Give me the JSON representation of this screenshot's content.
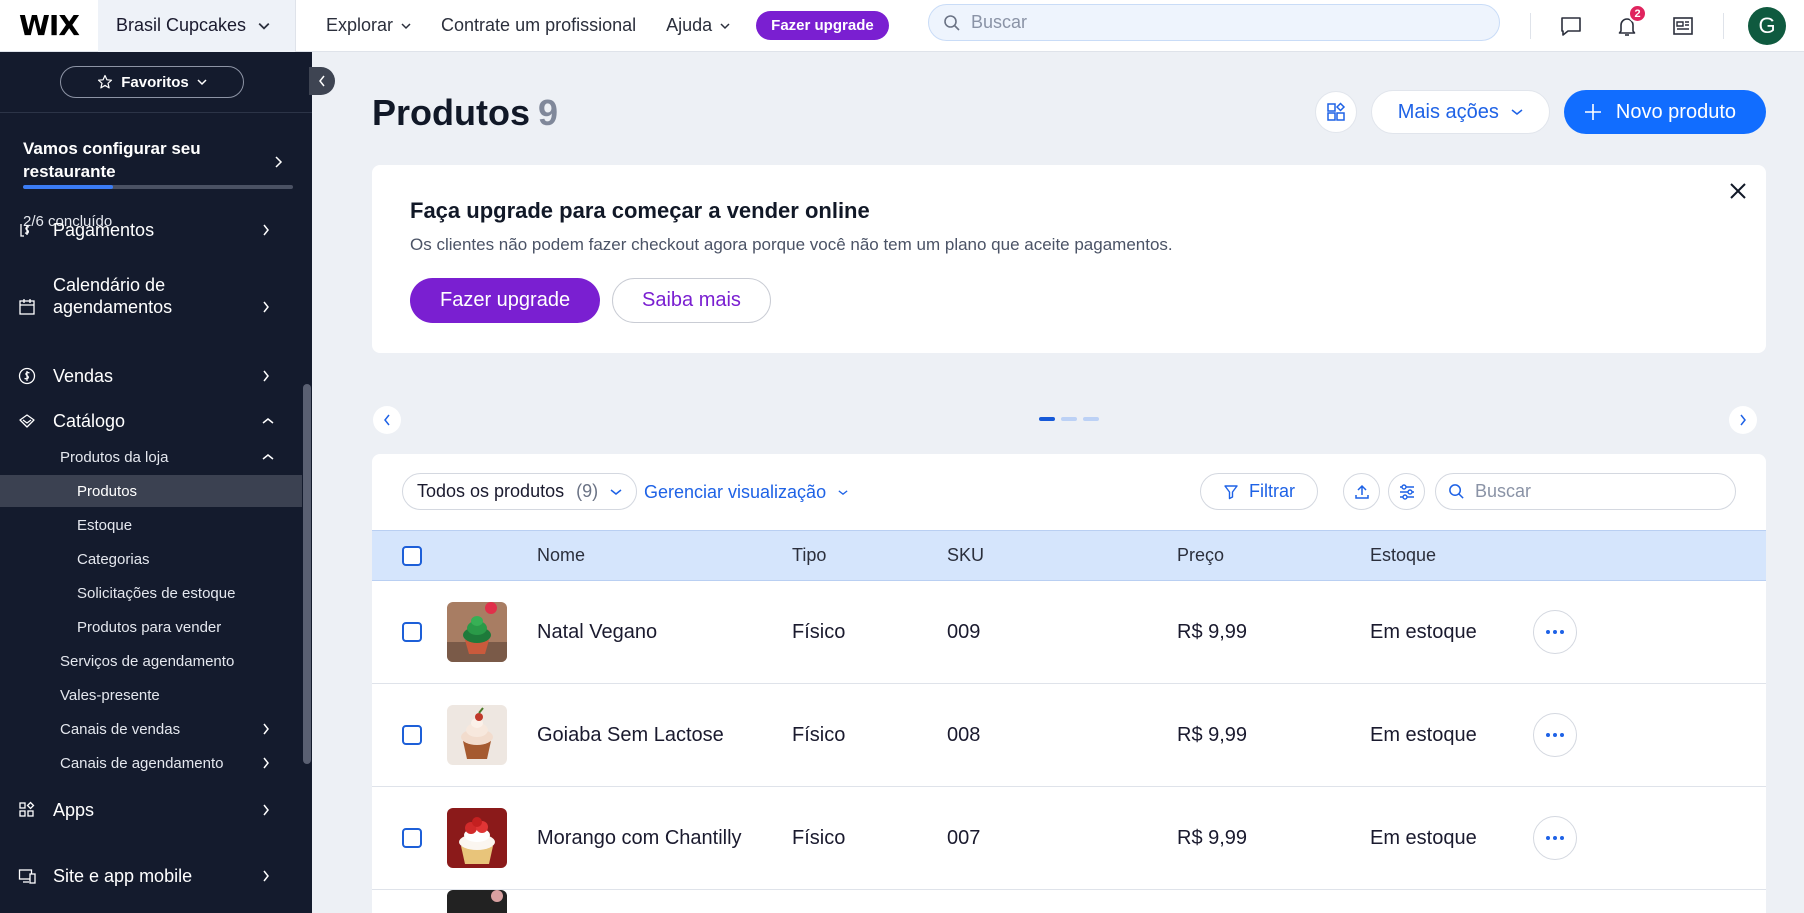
{
  "topbar": {
    "logo": "WIX",
    "site_name": "Brasil Cupcakes",
    "nav": [
      {
        "label": "Explorar",
        "has_dropdown": true
      },
      {
        "label": "Contrate um profissional",
        "has_dropdown": false
      },
      {
        "label": "Ajuda",
        "has_dropdown": true
      }
    ],
    "upgrade_label": "Fazer upgrade",
    "search_placeholder": "Buscar",
    "notification_count": "2",
    "avatar_initial": "G"
  },
  "sidebar": {
    "favorites_label": "Favoritos",
    "setup": {
      "title": "Vamos configurar seu restaurante",
      "status": "2/6 concluído",
      "progress_fraction": 0.333
    },
    "items": [
      {
        "label": "Pagamentos",
        "icon": "payments-icon"
      },
      {
        "label": "Calendário de agendamentos",
        "icon": "calendar-icon"
      },
      {
        "label": "Vendas",
        "icon": "dollar-icon"
      },
      {
        "label": "Catálogo",
        "icon": "catalog-icon"
      },
      {
        "label": "Apps",
        "icon": "apps-icon"
      },
      {
        "label": "Site e app mobile",
        "icon": "site-icon"
      }
    ],
    "catalog_sub": [
      {
        "label": "Produtos da loja"
      },
      {
        "label": "Produtos"
      },
      {
        "label": "Estoque"
      },
      {
        "label": "Categorias"
      },
      {
        "label": "Solicitações de estoque"
      },
      {
        "label": "Produtos para vender"
      },
      {
        "label": "Serviços de agendamento"
      },
      {
        "label": "Vales-presente"
      },
      {
        "label": "Canais de vendas"
      },
      {
        "label": "Canais de agendamento"
      }
    ]
  },
  "main": {
    "title": "Produtos",
    "count": "9",
    "more_actions": "Mais ações",
    "new_product": "Novo produto",
    "banner": {
      "title": "Faça upgrade para começar a vender online",
      "description": "Os clientes não podem fazer checkout agora porque você não tem um plano que aceite pagamentos.",
      "primary": "Fazer upgrade",
      "secondary": "Saiba mais"
    },
    "carousel": {
      "pages": 3,
      "active": 1
    },
    "toolbar": {
      "view_label": "Todos os produtos",
      "view_count": "(9)",
      "manage_view": "Gerenciar visualização",
      "filter": "Filtrar",
      "search_placeholder": "Buscar"
    },
    "table": {
      "columns": [
        "Nome",
        "Tipo",
        "SKU",
        "Preço",
        "Estoque"
      ],
      "rows": [
        {
          "name": "Natal Vegano",
          "type": "Físico",
          "sku": "009",
          "price": "R$ 9,99",
          "stock": "Em estoque"
        },
        {
          "name": "Goiaba Sem Lactose",
          "type": "Físico",
          "sku": "008",
          "price": "R$ 9,99",
          "stock": "Em estoque"
        },
        {
          "name": "Morango com Chantilly",
          "type": "Físico",
          "sku": "007",
          "price": "R$ 9,99",
          "stock": "Em estoque"
        }
      ]
    }
  },
  "colors": {
    "brand_blue": "#116dff",
    "upgrade_purple": "#7a1fd1",
    "sidebar_bg": "#141b2d",
    "table_header_bg": "#d5e5fc"
  }
}
